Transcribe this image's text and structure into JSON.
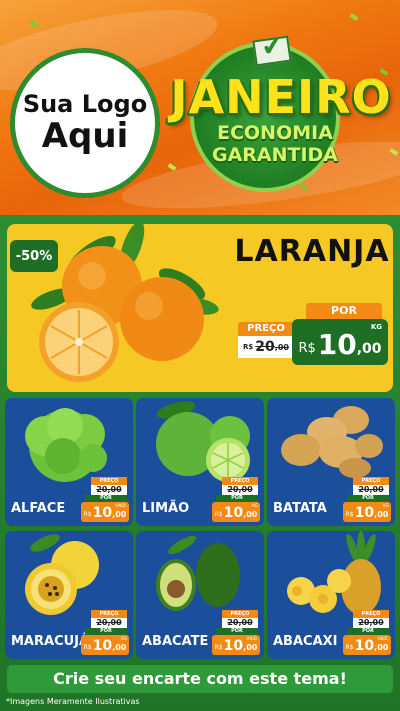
{
  "header": {
    "logo_line1": "Sua Logo",
    "logo_line2": "Aqui",
    "title": "JANEIRO",
    "subtitle_line1": "ECONOMIA",
    "subtitle_line2": "GARANTIDA"
  },
  "featured": {
    "discount": "-50%",
    "name": "LARANJA",
    "por_label": "POR",
    "preco_label": "PREÇO",
    "old_price_currency": "R$",
    "old_price_whole": "20",
    "old_price_cents": ",00",
    "new_price_currency": "R$",
    "new_price_whole": "10",
    "new_price_cents": ",00",
    "unit": "KG"
  },
  "products": [
    {
      "name": "ALFACE",
      "preco_label": "PREÇO",
      "old_price": "20,00",
      "por_label": "POR",
      "currency": "R$",
      "whole": "10",
      "cents": ",00",
      "unit": "UNID."
    },
    {
      "name": "LIMÃO",
      "preco_label": "PREÇO",
      "old_price": "20,00",
      "por_label": "POR",
      "currency": "R$",
      "whole": "10",
      "cents": ",00",
      "unit": "KG"
    },
    {
      "name": "BATATA",
      "preco_label": "PREÇO",
      "old_price": "20,00",
      "por_label": "POR",
      "currency": "R$",
      "whole": "10",
      "cents": ",00",
      "unit": "KG"
    },
    {
      "name": "MARACUJÁ",
      "preco_label": "PREÇO",
      "old_price": "20,00",
      "por_label": "POR",
      "currency": "R$",
      "whole": "10",
      "cents": ",00",
      "unit": "KG"
    },
    {
      "name": "ABACATE",
      "preco_label": "PREÇO",
      "old_price": "20,00",
      "por_label": "POR",
      "currency": "R$",
      "whole": "10",
      "cents": ",00",
      "unit": "UNID."
    },
    {
      "name": "ABACAXI",
      "preco_label": "PREÇO",
      "old_price": "20,00",
      "por_label": "POR",
      "currency": "R$",
      "whole": "10",
      "cents": ",00",
      "unit": "UNID."
    }
  ],
  "footer": {
    "cta": "Crie seu encarte com este tema!",
    "disclaimer": "*Imagens Meramente Ilustrativas"
  },
  "colors": {
    "orange": "#f07a12",
    "green": "#1e6f25",
    "yellow": "#f6c824",
    "blue": "#1b4f9c"
  }
}
